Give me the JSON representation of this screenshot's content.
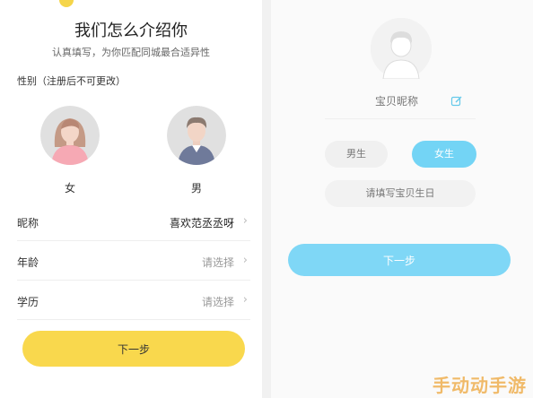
{
  "left": {
    "title": "我们怎么介绍你",
    "subtitle": "认真填写，为你匹配同城最合适异性",
    "gender_label": "性别（注册后不可更改）",
    "female_label": "女",
    "male_label": "男",
    "rows": [
      {
        "label": "昵称",
        "value": "喜欢范丞丞呀",
        "filled": true
      },
      {
        "label": "年龄",
        "value": "请选择",
        "filled": false
      },
      {
        "label": "学历",
        "value": "请选择",
        "filled": false
      }
    ],
    "next_label": "下一步",
    "accent": "#f9d84d"
  },
  "right": {
    "nickname_placeholder": "宝贝昵称",
    "male_pill": "男生",
    "female_pill": "女生",
    "birthday_placeholder": "请填写宝贝生日",
    "next_label": "下一步",
    "accent": "#7fd7f6"
  },
  "watermark": "手动动手游"
}
